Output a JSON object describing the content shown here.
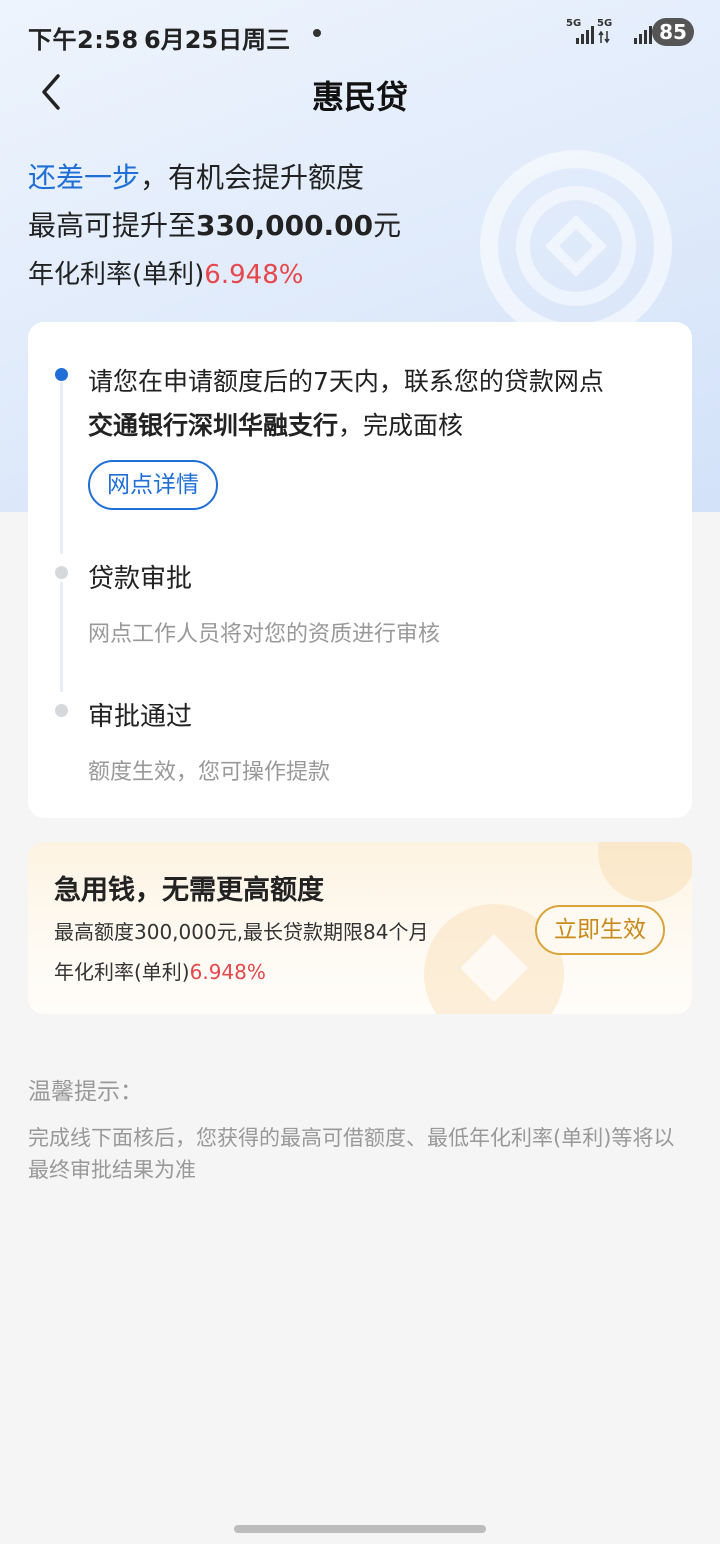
{
  "status_bar": {
    "time": "下午2:58",
    "date": "6月25日周三",
    "signal1_label": "5G",
    "signal2_label": "5G",
    "battery": "85"
  },
  "header": {
    "title": "惠民贷",
    "back_icon": "chevron-left-icon"
  },
  "hero": {
    "highlight": "还差一步",
    "line1_rest": "，有机会提升额度",
    "line2_prefix": "最高可提升至",
    "line2_amount": "330,000.00",
    "line2_suffix": "元",
    "line3_prefix": "年化利率(单利)",
    "line3_rate": "6.948%"
  },
  "steps": {
    "step1_text_a": "请您在申请额度后的7天内，联系您的贷款网点",
    "step1_bank": "交通银行深圳华融支行",
    "step1_text_b": "，完成面核",
    "branch_button": "网点详情",
    "step2_title": "贷款审批",
    "step2_desc": "网点工作人员将对您的资质进行审核",
    "step3_title": "审批通过",
    "step3_desc": "额度生效，您可操作提款"
  },
  "offer": {
    "title": "急用钱，无需更高额度",
    "line1": "最高额度300,000元,最长贷款期限84个月",
    "line2_prefix": "年化利率(单利)",
    "line2_rate": "6.948%",
    "button": "立即生效"
  },
  "tips": {
    "title": "温馨提示：",
    "body": "完成线下面核后，您获得的最高可借额度、最低年化利率(单利)等将以最终审批结果为准"
  },
  "colors": {
    "accent_blue": "#1f6fd6",
    "rate_red": "#e5474d",
    "gold": "#c98a1c"
  }
}
